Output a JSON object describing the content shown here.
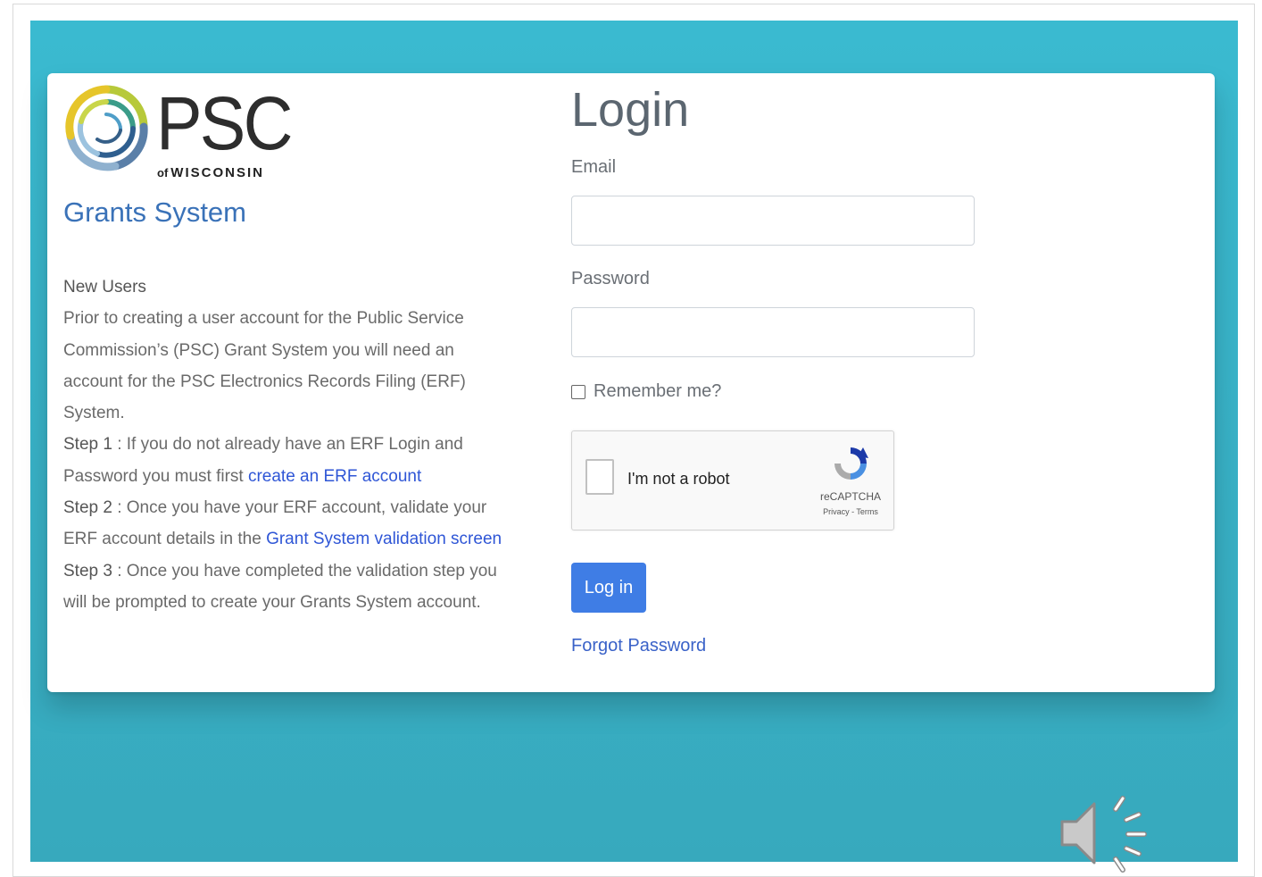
{
  "logo": {
    "word": "PSC",
    "sub_of": "of",
    "sub_state": "WISCONSIN",
    "icon": "psc-swirl-logo"
  },
  "system_title": "Grants System",
  "new_users": {
    "heading": "New Users",
    "intro": "Prior to creating a user account for the Public Service Commission’s (PSC) Grant System you will need an account for the PSC Electronics Records Filing (ERF) System.",
    "step1_label": "Step 1",
    "step1_text": " : If you do not already have an ERF Login and Password you must first ",
    "step1_link": "create an ERF account",
    "step2_label": "Step 2",
    "step2_text": " : Once you have your ERF account, validate your ERF account details in the ",
    "step2_link": "Grant System validation screen",
    "step3_label": "Step 3",
    "step3_text": " : Once you have completed the validation step you will be prompted to create your Grants System account."
  },
  "login": {
    "title": "Login",
    "email_label": "Email",
    "email_value": "",
    "password_label": "Password",
    "password_value": "",
    "remember_label": "Remember me?",
    "remember_checked": false,
    "button_label": "Log in",
    "forgot_label": "Forgot Password"
  },
  "recaptcha": {
    "label": "I'm not a robot",
    "brand": "reCAPTCHA",
    "terms": "Privacy - Terms",
    "icon": "recaptcha-icon"
  },
  "colors": {
    "teal_background": "#3ab5cb",
    "link_blue": "#2f56d6",
    "title_blue": "#3a72b8",
    "button_blue": "#3f7de5"
  },
  "overlay": {
    "icon": "speaker-icon"
  }
}
